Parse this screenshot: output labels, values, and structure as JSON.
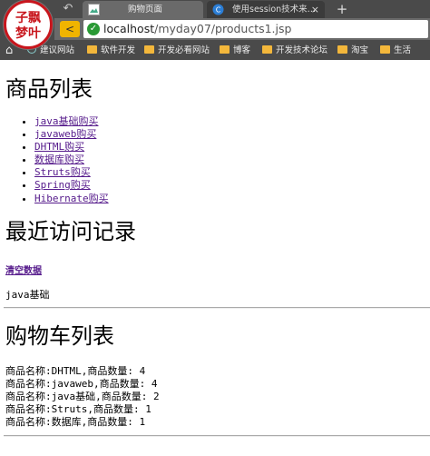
{
  "browser": {
    "logo_text_top": "子飘",
    "logo_text_bottom": "梦叶",
    "tabs": [
      {
        "title": "购物页面",
        "active": true
      },
      {
        "title": "使用session技术来…",
        "active": false
      }
    ],
    "new_tab": "+",
    "url_host": "localhost",
    "url_path": "/myday07/products1.jsp",
    "bookmarks": [
      "建议网站",
      "软件开发",
      "开发必看网站",
      "博客",
      "开发技术论坛",
      "淘宝",
      "生活"
    ]
  },
  "page": {
    "products_title": "商品列表",
    "products": [
      "java基础购买",
      "javaweb购买",
      "DHTML购买",
      "数据库购买",
      "Struts购买",
      "Spring购买",
      "Hibernate购买"
    ],
    "history_title": "最近访问记录",
    "clear_label": "清空数据",
    "history_items": [
      "java基础"
    ],
    "cart_title": "购物车列表",
    "cart_rows": [
      "商品名称:DHTML,商品数量: 4",
      "商品名称:javaweb,商品数量: 4",
      "商品名称:java基础,商品数量: 2",
      "商品名称:Struts,商品数量: 1",
      "商品名称:数据库,商品数量: 1"
    ]
  }
}
